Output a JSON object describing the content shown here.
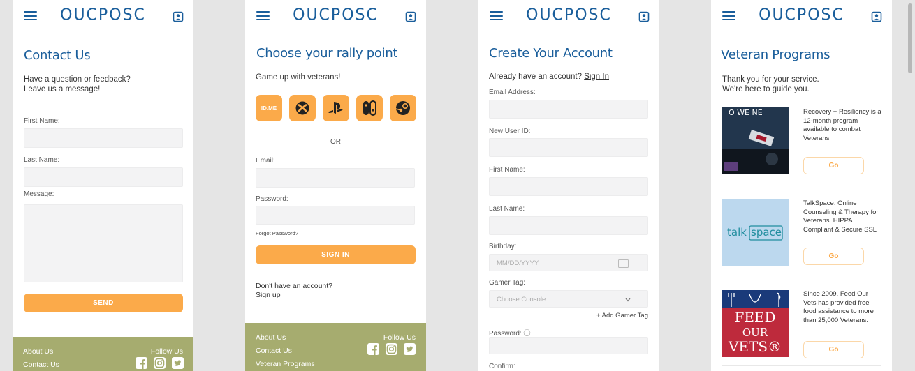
{
  "brand": {
    "logo": "OUCPOSC",
    "primary": "#1a5e9b",
    "accent": "#fbaa4a",
    "footer_bg": "#a6ac6f"
  },
  "footer": {
    "about": "About Us",
    "contact": "Contact Us",
    "veterans": "Veteran Programs",
    "follow": "Follow Us",
    "social": [
      "facebook-icon",
      "instagram-icon",
      "twitter-icon"
    ]
  },
  "contact": {
    "title": "Contact Us",
    "intro_line1": "Have a question or feedback?",
    "intro_line2": "Leave us a message!",
    "first_name_label": "First Name:",
    "last_name_label": "Last Name:",
    "message_label": "Message:",
    "send_label": "SEND"
  },
  "rally": {
    "title": "Choose your rally point",
    "subtitle": "Game up with veterans!",
    "platforms": [
      "ID.ME",
      "xbox-icon",
      "playstation-icon",
      "switch-icon",
      "steam-icon"
    ],
    "or": "OR",
    "email_label": "Email:",
    "password_label": "Password:",
    "forgot": "Forgot Password?",
    "signin_label": "SIGN IN",
    "no_account": "Don't have an account?",
    "signup": "Sign up"
  },
  "account": {
    "title": "Create Your Account",
    "have_account": "Already have an account?",
    "signin": "Sign In",
    "email_label": "Email Address:",
    "userid_label": "New User ID:",
    "first_label": "First Name:",
    "last_label": "Last Name:",
    "birthday_label": "Birthday:",
    "birthday_placeholder": "MM/DD/YYYY",
    "gamertag_label": "Gamer Tag:",
    "console_placeholder": "Choose Console",
    "add_gamertag": "+ Add Gamer Tag",
    "password_label": "Password: ⓘ",
    "confirm_label": "Confirm:"
  },
  "veteran": {
    "title": "Veteran Programs",
    "intro_line1": "Thank you for your service.",
    "intro_line2": "We're here to guide you.",
    "cards": [
      {
        "text": "Recovery + Resiliency is a 12-month program available to combat Veterans",
        "go": "Go"
      },
      {
        "text": "TalkSpace: Online Counseling & Therapy for Veterans. HIPPA Compliant & Secure SSL",
        "go": "Go",
        "logo": "talkspace"
      },
      {
        "text": "Since 2009, Feed Our Vets has provided free food assistance to more than 25,000 Veterans.",
        "go": "Go",
        "logo_line1": "FEED",
        "logo_line2": "OUR",
        "logo_line3": "VETS®"
      }
    ]
  }
}
